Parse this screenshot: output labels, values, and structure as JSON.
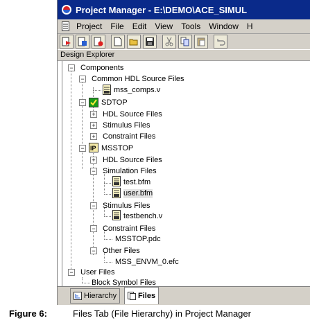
{
  "window": {
    "title": "Project Manager - E:\\DEMO\\ACE_SIMUL"
  },
  "menu": [
    "Project",
    "File",
    "Edit",
    "View",
    "Tools",
    "Window",
    "H"
  ],
  "toolbar_icons": [
    "new-project-icon",
    "open-project-icon",
    "close-project-icon",
    "new-file-icon",
    "open-folder-icon",
    "save-icon",
    "cut-icon",
    "copy-icon",
    "paste-icon",
    "undo-icon"
  ],
  "panel": {
    "title": "Design Explorer"
  },
  "tree": {
    "components": "Components",
    "common_hdl": "Common HDL Source Files",
    "mss_comps": "mss_comps.v",
    "sdtop": "SDTOP",
    "sdtop_hdl": "HDL Source Files",
    "sdtop_stim": "Stimulus Files",
    "sdtop_constr": "Constraint Files",
    "msstop": "MSSTOP",
    "mss_hdl": "HDL Source Files",
    "mss_sim": "Simulation Files",
    "test_bfm": "test.bfm",
    "user_bfm": "user.bfm",
    "mss_stim": "Stimulus Files",
    "testbench": "testbench.v",
    "mss_constr": "Constraint Files",
    "pdc": "MSSTOP.pdc",
    "mss_other": "Other Files",
    "efc": "MSS_ENVM_0.efc",
    "user_files": "User Files",
    "block_symbol": "Block Symbol Files"
  },
  "tabs": {
    "hierarchy": "Hierarchy",
    "files": "Files"
  },
  "caption": {
    "label": "Figure 6:",
    "text": "Files Tab (File Hierarchy) in Project Manager"
  },
  "colors": {
    "titlebar": "#0a2a8a",
    "chrome": "#d4d0c8",
    "sdtop_icon": "#1a9a1a"
  }
}
